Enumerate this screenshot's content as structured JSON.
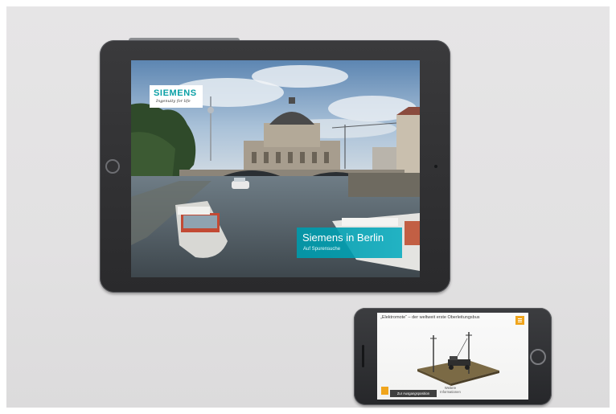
{
  "tablet": {
    "logo": {
      "brand": "SIEMENS",
      "tagline": "Ingenuity for life"
    },
    "title_card": {
      "title": "Siemens in Berlin",
      "subtitle": "Auf Spurensuche"
    }
  },
  "phone": {
    "title": "„Elektromote“ – der weltweit erste Oberleitungsbus",
    "menu_icon": "hamburger-menu-icon",
    "start_button": "Zur Ausgangsposition",
    "more_info": "Weitere Informationen"
  },
  "colors": {
    "siemens_teal": "#009999",
    "accent_orange": "#f0a51d",
    "device_frame": "#2e2f32",
    "background": "#e3e2e3"
  }
}
